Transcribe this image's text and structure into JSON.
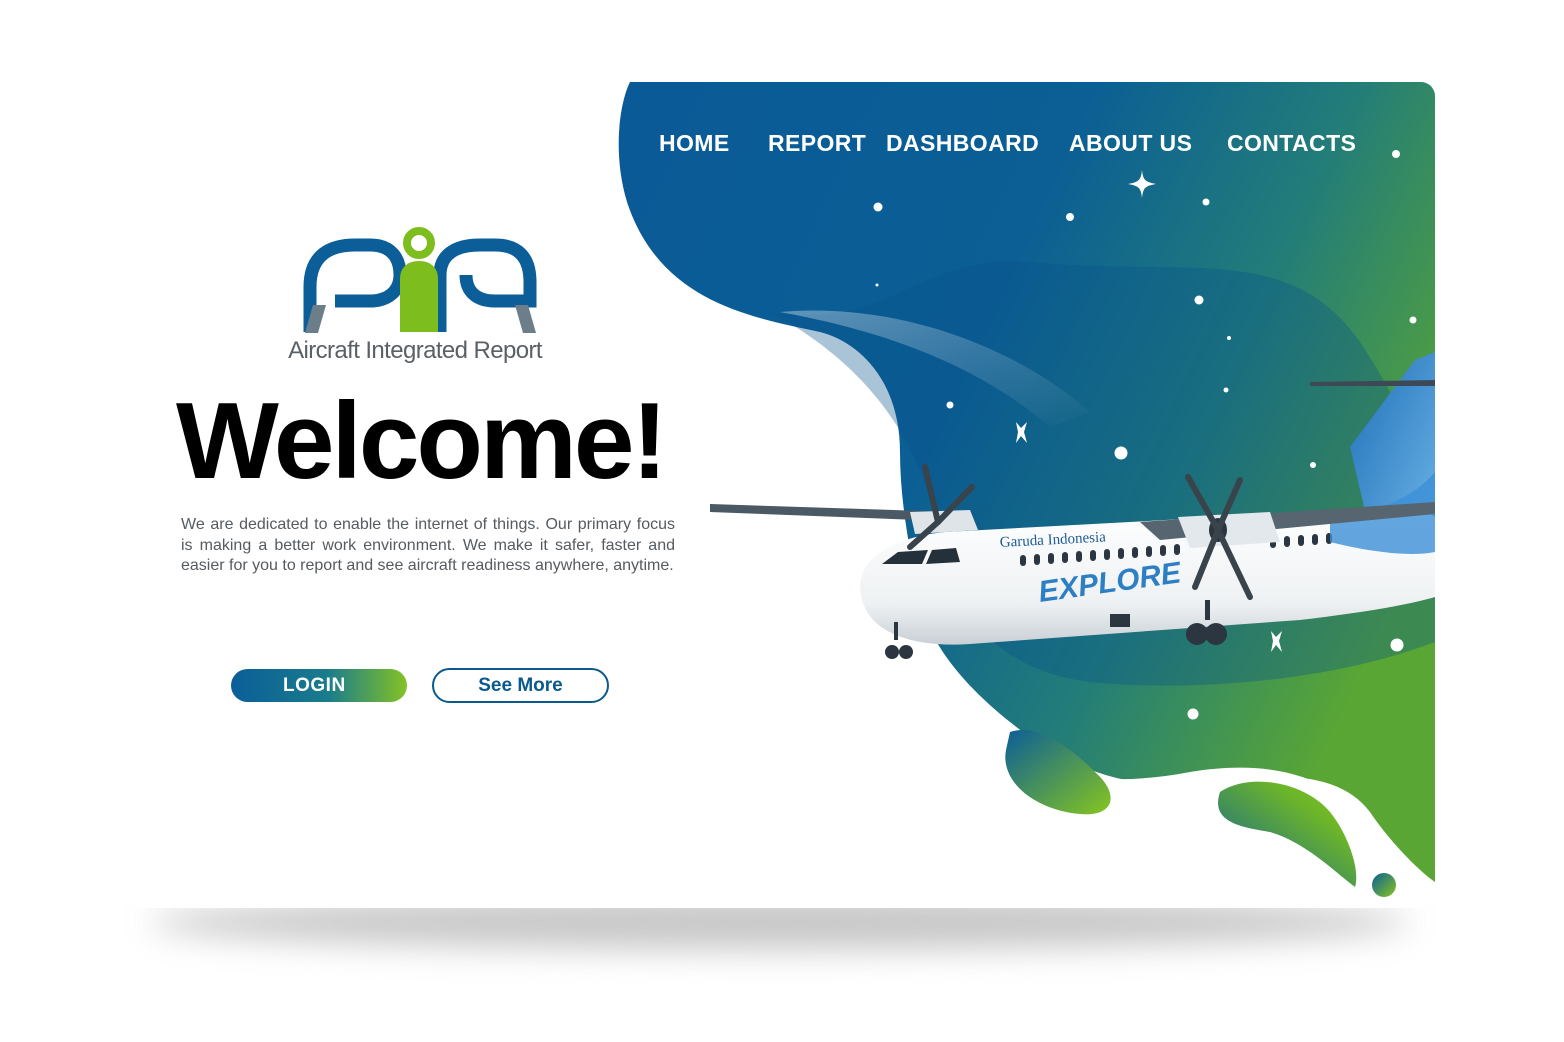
{
  "nav": {
    "items": [
      {
        "label": "HOME"
      },
      {
        "label": "REPORT"
      },
      {
        "label": "DASHBOARD"
      },
      {
        "label": "ABOUT US"
      },
      {
        "label": "CONTACTS"
      }
    ]
  },
  "brand": {
    "tagline": "Aircraft Integrated Report",
    "logo_letters": "AIR"
  },
  "hero": {
    "title": "Welcome!",
    "description": "We are dedicated to enable the internet of things. Our primary focus is making a better work environment. We make it safer, faster and easier for you to report and see aircraft readiness anywhere, anytime."
  },
  "buttons": {
    "login": "LOGIN",
    "see_more": "See More"
  },
  "aircraft": {
    "livery_name": "Garuda Indonesia",
    "livery_tag": "EXPLORE"
  },
  "colors": {
    "brand_blue": "#0b5e98",
    "brand_green": "#84c225",
    "teal": "#1a7c8c",
    "text_dark": "#000000"
  },
  "icons": [
    "star-dot-icon",
    "sparkle-icon",
    "cross-sparkle-icon",
    "airplane-illustration"
  ]
}
